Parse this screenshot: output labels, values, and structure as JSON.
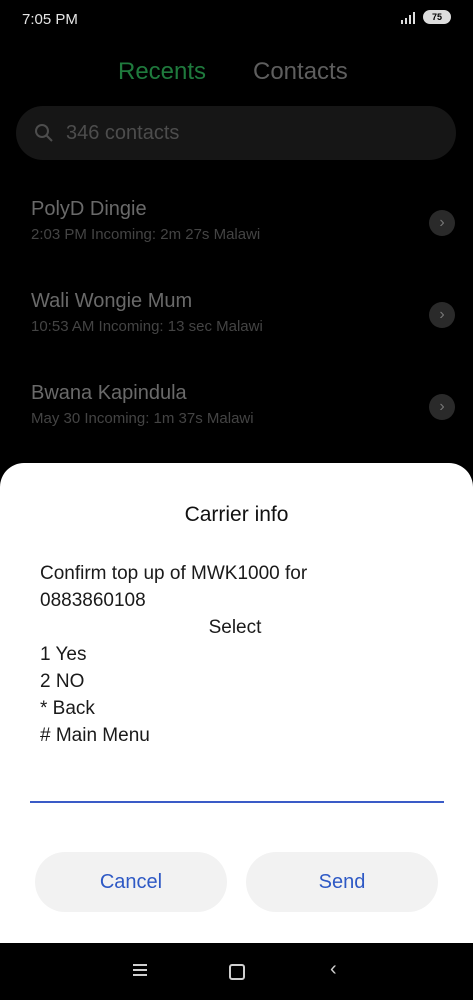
{
  "status_bar": {
    "time": "7:05 PM",
    "battery": "75"
  },
  "tabs": [
    {
      "label": "Recents"
    },
    {
      "label": "Contacts"
    }
  ],
  "search": {
    "placeholder": "346 contacts"
  },
  "recents": [
    {
      "name": "PolyD Dingie",
      "detail": "2:03 PM Incoming: 2m 27s Malawi"
    },
    {
      "name": "Wali Wongie Mum",
      "detail": "10:53 AM Incoming: 13 sec Malawi"
    },
    {
      "name": "Bwana Kapindula",
      "detail": "May 30 Incoming: 1m 37s Malawi"
    }
  ],
  "dialog": {
    "title": "Carrier info",
    "message": {
      "line1": "Confirm top up of MWK1000 for",
      "line2": "0883860108",
      "select": "Select",
      "opt1": "1 Yes",
      "opt2": "2 NO",
      "opt3": "* Back",
      "opt4": "# Main Menu"
    },
    "cancel_label": "Cancel",
    "send_label": "Send"
  },
  "icons": {
    "search": "search-icon",
    "arrow": "chevron-right-icon",
    "menu": "menu-icon",
    "home": "home-icon",
    "back": "back-icon"
  }
}
